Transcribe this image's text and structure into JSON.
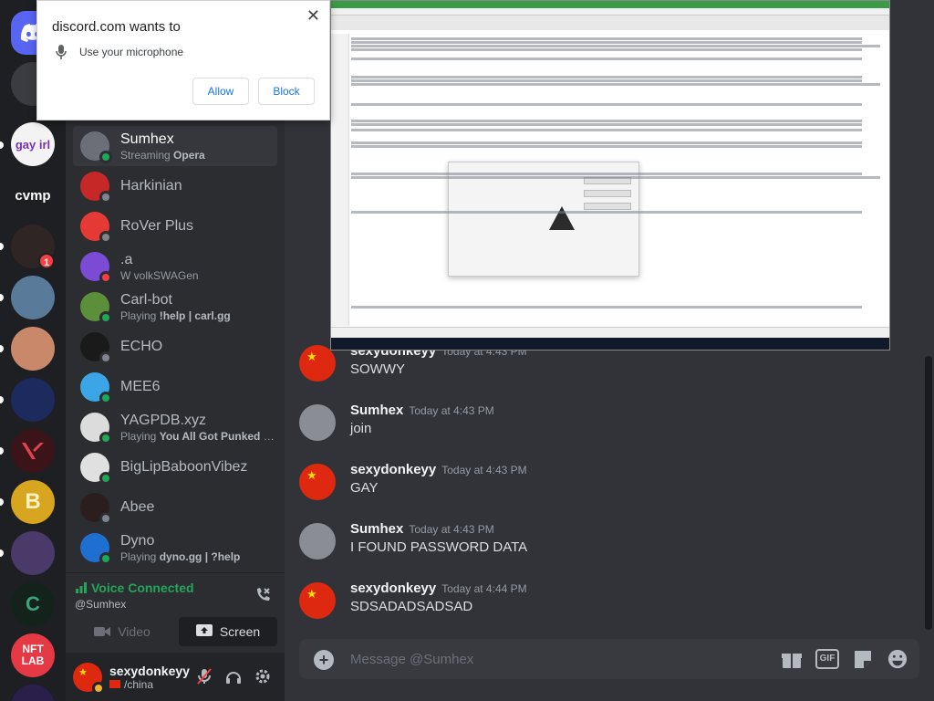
{
  "permission_prompt": {
    "title": "discord.com wants to",
    "request": "Use your microphone",
    "allow_label": "Allow",
    "block_label": "Block"
  },
  "servers": [
    {
      "name": "Discord Home",
      "icon": "discord-logo-icon"
    },
    {
      "text": "gay irl"
    },
    {
      "text": "cvmp"
    },
    {
      "badge": "1"
    },
    {
      "text": "NFT LAB"
    }
  ],
  "members": [
    {
      "name": "Sumhex",
      "sub_prefix": "Streaming",
      "sub_bold": "Opera",
      "status": "#23a55a",
      "avatar": "#6d6f78"
    },
    {
      "name": "Harkinian",
      "sub_prefix": "",
      "sub_bold": "",
      "status": "#80848e",
      "avatar": "#c62828"
    },
    {
      "name": "RoVer Plus",
      "sub_prefix": "",
      "sub_bold": "",
      "status": "#80848e",
      "avatar": "#e53935"
    },
    {
      "name": ".a",
      "sub_prefix": "W volkSWAGen",
      "sub_bold": "",
      "status": "#f23f43",
      "avatar": "#7b4bd6"
    },
    {
      "name": "Carl-bot",
      "sub_prefix": "Playing",
      "sub_bold": "!help | carl.gg",
      "status": "#23a55a",
      "avatar": "#5c8f3a"
    },
    {
      "name": "ECHO",
      "sub_prefix": "",
      "sub_bold": "",
      "status": "#80848e",
      "avatar": "#1a1a1a"
    },
    {
      "name": "MEE6",
      "sub_prefix": "",
      "sub_bold": "",
      "status": "#23a55a",
      "avatar": "#3ba5e6"
    },
    {
      "name": "YAGPDB.xyz",
      "sub_prefix": "Playing",
      "sub_bold": "You All Got Punked Du...",
      "status": "#23a55a",
      "avatar": "#dcdcdc"
    },
    {
      "name": "BigLipBaboonVibez",
      "sub_prefix": "",
      "sub_bold": "",
      "status": "#23a55a",
      "avatar": "#e0e0e0"
    },
    {
      "name": "Abee",
      "sub_prefix": "",
      "sub_bold": "",
      "status": "#80848e",
      "avatar": "#2a1e1e"
    },
    {
      "name": "Dyno",
      "sub_prefix": "Playing",
      "sub_bold": "dyno.gg | ?help",
      "status": "#23a55a",
      "avatar": "#1f6fd1"
    }
  ],
  "voice": {
    "status": "Voice Connected",
    "channel": "@Sumhex",
    "video_label": "Video",
    "screen_label": "Screen"
  },
  "user": {
    "name": "sexydonkeyy",
    "status": "/china"
  },
  "messages": [
    {
      "author": "sexydonkeyy",
      "time": "Today at 4:43 PM",
      "text": "SOWWY",
      "avatar": "flag"
    },
    {
      "author": "Sumhex",
      "time": "Today at 4:43 PM",
      "text": "join",
      "avatar": "gray"
    },
    {
      "author": "sexydonkeyy",
      "time": "Today at 4:43 PM",
      "text": "GAY",
      "avatar": "flag"
    },
    {
      "author": "Sumhex",
      "time": "Today at 4:43 PM",
      "text": "I FOUND PASSWORD DATA",
      "avatar": "gray"
    },
    {
      "author": "sexydonkeyy",
      "time": "Today at 4:44 PM",
      "text": "SDSADADSADSAD",
      "avatar": "flag"
    }
  ],
  "composer": {
    "placeholder": "Message @Sumhex",
    "gif_label": "GIF"
  },
  "colors": {
    "accent": "#5865f2",
    "online": "#23a55a",
    "dnd": "#f23f43"
  }
}
